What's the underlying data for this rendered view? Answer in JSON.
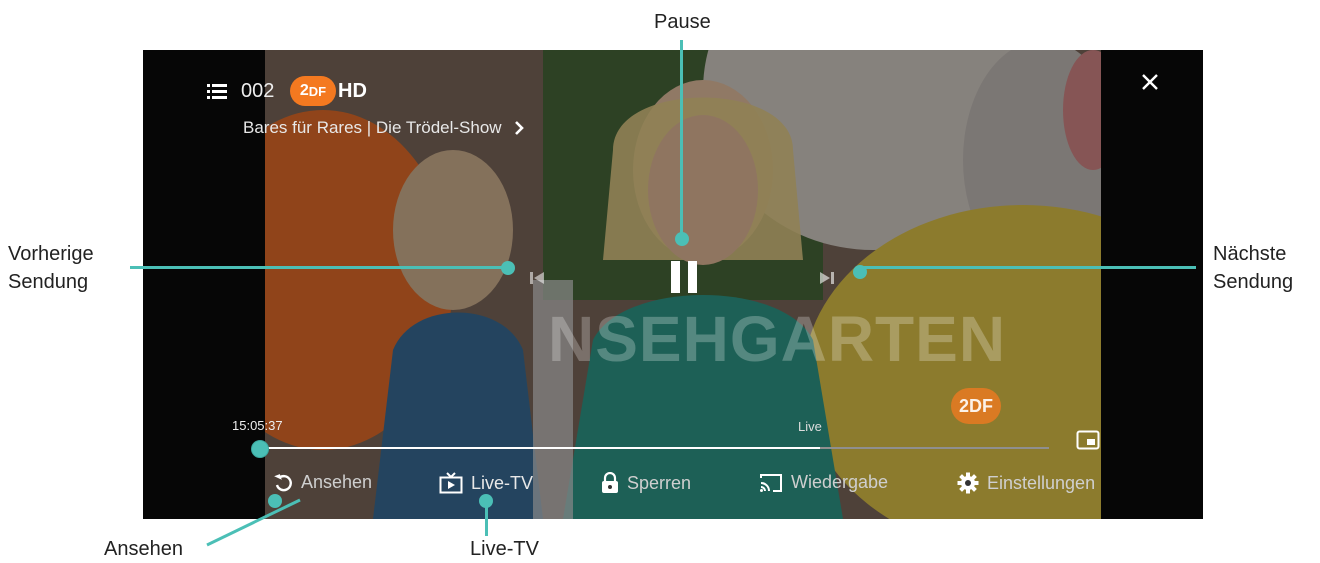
{
  "player": {
    "channel_number": "002",
    "channel_logo": "ZDF HD",
    "logo_letters_2": "2",
    "logo_letters_df": "DF",
    "logo_letters_hd": "HD",
    "program_title": "Bares für Rares | Die Trödel-Show",
    "background_text": "NSEHGARTEN",
    "watermark": "2DF",
    "time_current": "15:05:37",
    "live_label": "Live",
    "progress_fraction": 0.71
  },
  "controls": {
    "ansehen": "Ansehen",
    "live_tv": "Live-TV",
    "sperren": "Sperren",
    "wiedergabe": "Wiedergabe",
    "einstellungen": "Einstellungen"
  },
  "annotations": {
    "pause": "Pause",
    "previous_line1": "Vorherige",
    "previous_line2": "Sendung",
    "next_line1": "Nächste",
    "next_line2": "Sendung",
    "ansehen": "Ansehen",
    "live_tv": "Live-TV"
  },
  "colors": {
    "accent": "#4bbfb6",
    "zdf_orange": "#f47920",
    "progress_track": "#8f8f8f",
    "progress_fill": "#ffffff"
  },
  "icons": {
    "list": "list-icon",
    "close": "close-icon",
    "chevron": "chevron-right-icon",
    "prev": "skip-previous-icon",
    "pause": "pause-icon",
    "next": "skip-next-icon",
    "pip": "picture-in-picture-icon",
    "restart": "restart-icon",
    "tv": "tv-icon",
    "lock": "lock-icon",
    "cast": "cast-icon",
    "settings": "gear-icon"
  }
}
